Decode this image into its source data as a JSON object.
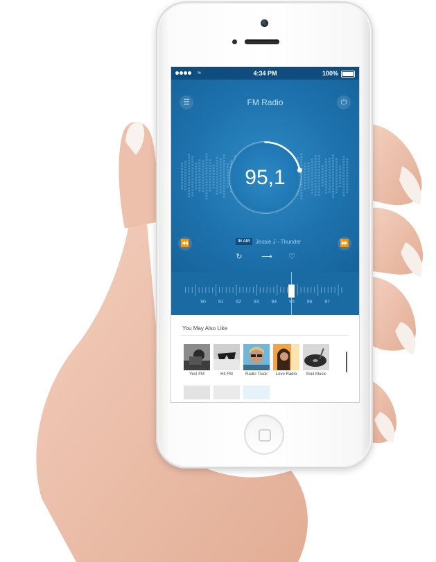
{
  "status_bar": {
    "time": "4:34 PM",
    "battery": "100%"
  },
  "header": {
    "title": "FM Radio"
  },
  "player": {
    "frequency": "95,1",
    "tuning_level": 0.62,
    "on_air_badge": "IN AIR",
    "now_playing": "Jessie J - Thunder"
  },
  "tuner": {
    "scale": [
      "90",
      "91",
      "92",
      "93",
      "94",
      "95",
      "96",
      "97"
    ]
  },
  "recommendations": {
    "title": "You May Also Like",
    "items": [
      {
        "label": "Yes! FM"
      },
      {
        "label": "Hit FM"
      },
      {
        "label": "Radio Track"
      },
      {
        "label": "Love Radio"
      },
      {
        "label": "Soul Music"
      }
    ]
  },
  "colors": {
    "accent": "#1d72ad",
    "status_bar": "#0e4d7e",
    "text_light": "#bfe0f4"
  },
  "icons": [
    "menu-icon",
    "power-icon",
    "rewind-icon",
    "fast-forward-icon",
    "repeat-icon",
    "share-icon",
    "heart-icon"
  ]
}
